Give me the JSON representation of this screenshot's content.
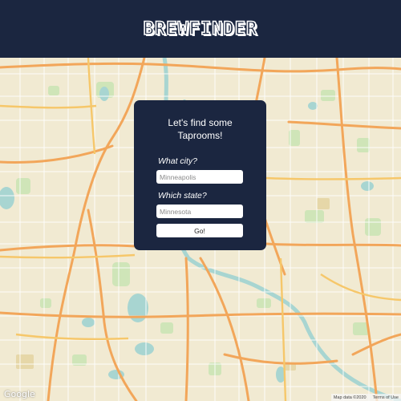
{
  "header": {
    "logo_text": "BREWFINDER"
  },
  "card": {
    "title_line1": "Let's find some",
    "title_line2": "Taprooms!",
    "city_label": "What city?",
    "city_placeholder": "Minneapolis",
    "state_label": "Which state?",
    "state_placeholder": "Minnesota",
    "submit_label": "Go!"
  },
  "map": {
    "google_logo": "Google",
    "map_data": "Map data ©2020",
    "terms": "Terms of Use"
  },
  "colors": {
    "header_bg": "#1b2640",
    "card_bg": "#1b2640",
    "map_land": "#f1ead2",
    "highway": "#f2a65a",
    "water": "#a8d5d1",
    "park": "#cfe5b8"
  }
}
